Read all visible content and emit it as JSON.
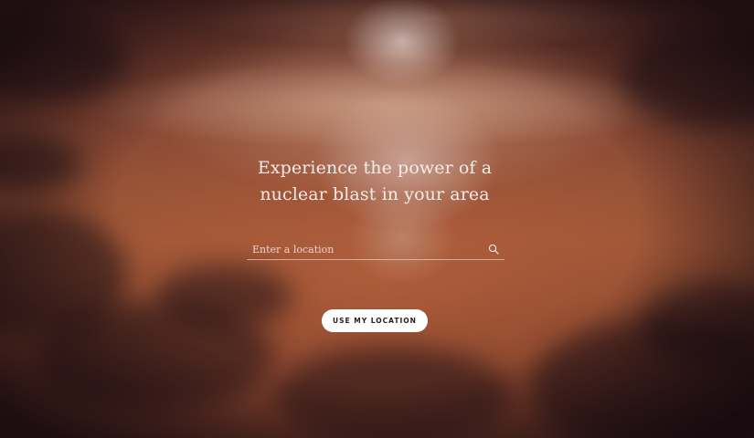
{
  "hero": {
    "headline": "Experience the power of a nuclear blast in your area"
  },
  "search": {
    "placeholder": "Enter a location",
    "value": "",
    "icon": "search-icon"
  },
  "actions": {
    "use_location_label": "USE MY LOCATION"
  },
  "colors": {
    "text": "#f4ece8",
    "button_bg": "#ffffff",
    "button_text": "#2a1a1a",
    "sky_mid": "#9a5536",
    "sky_dark": "#4a2520"
  }
}
